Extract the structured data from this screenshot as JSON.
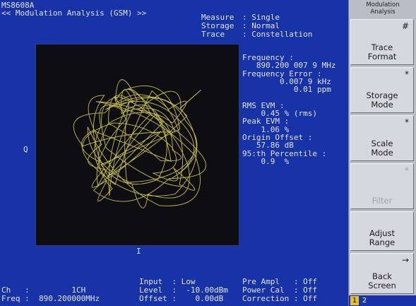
{
  "header": {
    "model": "MS8608A",
    "title": "<< Modulation Analysis (GSM) >>"
  },
  "settings": [
    {
      "label": "Measure",
      "value": ": Single"
    },
    {
      "label": "Storage",
      "value": ": Normal"
    },
    {
      "label": "Trace",
      "value": ": Constellation"
    }
  ],
  "plot": {
    "q_label": "Q",
    "i_label": "I",
    "trace_color": "#e8e14a"
  },
  "results": [
    "Frequency :",
    "   890.200 007 9 MHz",
    "Frequency Error :",
    "        0.007 9 kHz",
    "           0.01 ppm",
    "",
    "RMS EVM :",
    "    0.45 % (rms)",
    "Peak EVM :",
    "    1.06 %",
    "Origin Offset :",
    "   57.86 dB",
    "95:th Percentile :",
    "    0.9  %"
  ],
  "status": {
    "input": "Input  : Low",
    "level": "Level  :  -10.00dBm",
    "offset": "Offset :    0.00dB",
    "ch": "Ch   :         1CH",
    "freq": "Freq :  890.200000MHz",
    "pre_ampl": "Pre Ampl   : Off",
    "power_cal": "Power Cal  : Off",
    "correction": "Correction : Off"
  },
  "softkeys": {
    "title": "Modulation\nAnalysis",
    "buttons": [
      {
        "mark": "#",
        "label": "Trace\nFormat",
        "enabled": true
      },
      {
        "mark": "*",
        "label": "Storage\nMode",
        "enabled": true
      },
      {
        "mark": "*",
        "label": "Scale\nMode",
        "enabled": true
      },
      {
        "mark": "*",
        "label": "Filter",
        "enabled": false
      },
      {
        "mark": "",
        "label": "Adjust\nRange",
        "enabled": true
      },
      {
        "mark": "→",
        "label": "Back\nScreen",
        "enabled": true
      }
    ],
    "pages": [
      "1",
      "2"
    ]
  },
  "colors": {
    "screen_bg": "#1832a8",
    "plot_bg": "#0d0d12",
    "trace": "#e8e14a",
    "page_highlight": "#e6c21a"
  }
}
